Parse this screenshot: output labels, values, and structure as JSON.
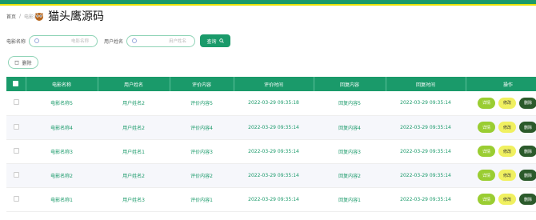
{
  "breadcrumb": {
    "home": "首页",
    "separator": "/",
    "current": "电影评论"
  },
  "watermark": {
    "text": "猫头鹰源码"
  },
  "search": {
    "movie_label": "电影名称",
    "movie_placeholder": "电影名称",
    "user_label": "用户姓名",
    "user_placeholder": "用户姓名",
    "search_button": "查询"
  },
  "actions": {
    "delete_button": "删除"
  },
  "table": {
    "columns": [
      "电影名称",
      "用户姓名",
      "评价内容",
      "评价时间",
      "回复内容",
      "回复时间",
      "操作"
    ],
    "rows": [
      {
        "movie": "电影名称5",
        "user": "用户姓名2",
        "content": "评价内容5",
        "time": "2022-03-29 09:35:18",
        "reply": "回复内容5",
        "reply_time": "2022-03-29 09:35:14"
      },
      {
        "movie": "电影名称4",
        "user": "用户姓名2",
        "content": "评价内容4",
        "time": "2022-03-29 09:35:14",
        "reply": "回复内容4",
        "reply_time": "2022-03-29 09:35:14"
      },
      {
        "movie": "电影名称3",
        "user": "用户姓名1",
        "content": "评价内容3",
        "time": "2022-03-29 09:35:14",
        "reply": "回复内容3",
        "reply_time": "2022-03-29 09:35:14"
      },
      {
        "movie": "电影名称2",
        "user": "用户姓名2",
        "content": "评价内容2",
        "time": "2022-03-29 09:35:14",
        "reply": "回复内容2",
        "reply_time": "2022-03-29 09:35:14"
      },
      {
        "movie": "电影名称1",
        "user": "用户姓名3",
        "content": "评价内容1",
        "time": "2022-03-29 09:35:14",
        "reply": "回复内容1",
        "reply_time": "2022-03-29 09:35:14"
      }
    ],
    "op_view": "详情",
    "op_edit": "修改",
    "op_delete": "删除"
  },
  "colors": {
    "primary": "#1a9a6a",
    "accent": "#e8e000",
    "view": "#9acd32",
    "edit": "#f0f060",
    "delete": "#2b5a2b"
  }
}
